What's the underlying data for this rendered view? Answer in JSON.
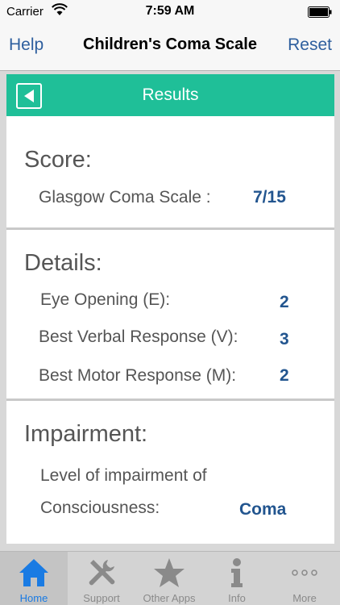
{
  "status_bar": {
    "carrier": "Carrier",
    "time": "7:59 AM"
  },
  "nav": {
    "help_label": "Help",
    "title": "Children's Coma Scale",
    "reset_label": "Reset"
  },
  "results": {
    "title": "Results"
  },
  "score": {
    "heading": "Score:",
    "gcs_label": "Glasgow Coma Scale :",
    "gcs_value": "7/15"
  },
  "details": {
    "heading": "Details:",
    "items": [
      {
        "label": "Eye Opening (E):",
        "value": "2"
      },
      {
        "label": "Best Verbal Response (V):",
        "value": "3"
      },
      {
        "label": "Best Motor Response (M):",
        "value": "2"
      }
    ]
  },
  "impairment": {
    "heading": "Impairment:",
    "label_line1": "Level of impairment of",
    "label_line2": "Consciousness:",
    "value": "Coma"
  },
  "tabs": [
    {
      "label": "Home",
      "icon": "home-icon",
      "active": true
    },
    {
      "label": "Support",
      "icon": "tools-icon",
      "active": false
    },
    {
      "label": "Other Apps",
      "icon": "star-icon",
      "active": false
    },
    {
      "label": "Info",
      "icon": "info-icon",
      "active": false
    },
    {
      "label": "More",
      "icon": "more-icon",
      "active": false
    }
  ],
  "colors": {
    "accent_green": "#1fbf98",
    "link_blue": "#2e5f9e",
    "value_blue": "#22558f",
    "active_tab_blue": "#1a7be3"
  }
}
